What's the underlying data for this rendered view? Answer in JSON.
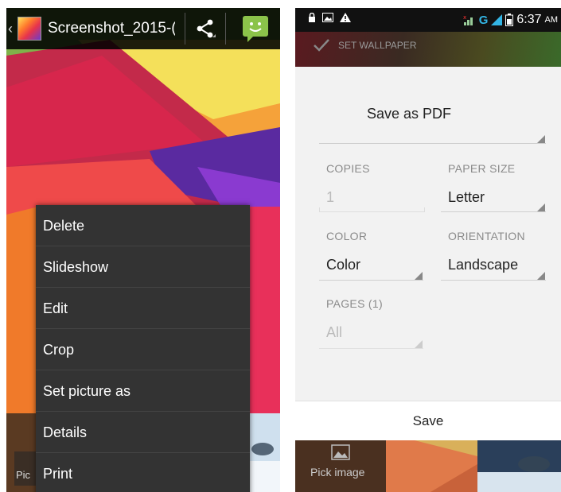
{
  "gallery": {
    "action_bar": {
      "title": "Screenshot_2015-(",
      "up_icon": "back-chevron-icon",
      "share_icon": "share-icon",
      "message_icon": "message-icon"
    },
    "menu": {
      "items": [
        {
          "label": "Delete"
        },
        {
          "label": "Slideshow"
        },
        {
          "label": "Edit"
        },
        {
          "label": "Crop"
        },
        {
          "label": "Set picture as"
        },
        {
          "label": "Details"
        },
        {
          "label": "Print"
        }
      ]
    },
    "filmstrip": {
      "pick_label": "Pic"
    }
  },
  "print_screen": {
    "status_bar": {
      "network": "G",
      "time": "6:37",
      "ampm": "AM"
    },
    "behind_title": "SET WALLPAPER",
    "printer": {
      "value": "Save as PDF"
    },
    "copies": {
      "label": "COPIES",
      "value": "1"
    },
    "paper_size": {
      "label": "PAPER SIZE",
      "value": "Letter"
    },
    "color": {
      "label": "COLOR",
      "value": "Color"
    },
    "orientation": {
      "label": "ORIENTATION",
      "value": "Landscape"
    },
    "pages": {
      "label": "PAGES (1)",
      "value": "All"
    },
    "save_label": "Save",
    "pick_image_label": "Pick image"
  },
  "colors": {
    "dialog_bg": "#f2f2f2",
    "menu_bg": "#333333",
    "label_gray": "#8a8a8a",
    "network_blue": "#33b5e5",
    "message_green": "#8bc34a"
  }
}
